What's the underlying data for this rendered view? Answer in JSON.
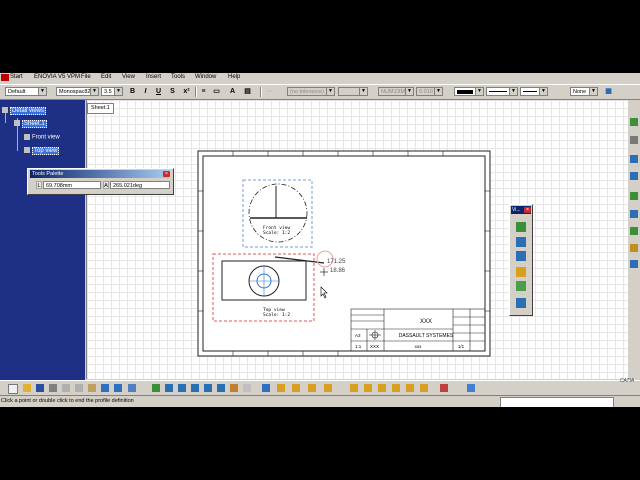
{
  "menubar": {
    "start": "Start",
    "items": [
      "ENOVIA V5 VPM",
      "File",
      "Edit",
      "View",
      "Insert",
      "Tools",
      "Window",
      "Help"
    ]
  },
  "toolbar1": {
    "style": "Default",
    "font": "Monospac821",
    "font_size": "3.5",
    "bold": "B",
    "italic": "I",
    "underline": "U",
    "tolerance": "(no tolerance)",
    "dim_format": "NUM.DIMM",
    "precision": "0.010",
    "line_color": "",
    "fill": "None"
  },
  "tree": {
    "root": "Detail views",
    "sheet": "Sheet.1",
    "views": [
      "Front view",
      "Top view"
    ]
  },
  "sheet_tab": "Sheet.1",
  "tools_palette": {
    "title": "Tools Palette",
    "length_label": "L",
    "length_value": "69.708mm",
    "angle_label": "A",
    "angle_value": "265.021deg"
  },
  "vtoolbar": {
    "title": "Vi..."
  },
  "drawing": {
    "front_view_label": "Front view",
    "front_view_scale": "Scale: 1:2",
    "top_view_label": "Top view",
    "top_view_scale": "Scale: 1:2",
    "dim_primary": "171.25",
    "dim_secondary": "18.86",
    "title_block_main": "XXX",
    "title_block_company": "DASSAULT SYSTEMES",
    "title_block_size": "A3",
    "title_block_scale": "1:1",
    "title_block_sheet_code": "XXX",
    "title_block_number": "xxx",
    "title_block_sheet": "1/1"
  },
  "statusbar": {
    "message": "Click a point or double click to end the profile definition"
  },
  "colors": {
    "tree_bg": "#1e2f86",
    "front_frame": "#6f9fd0",
    "top_frame": "#e05858",
    "title_gradient_start": "#0a246a"
  }
}
